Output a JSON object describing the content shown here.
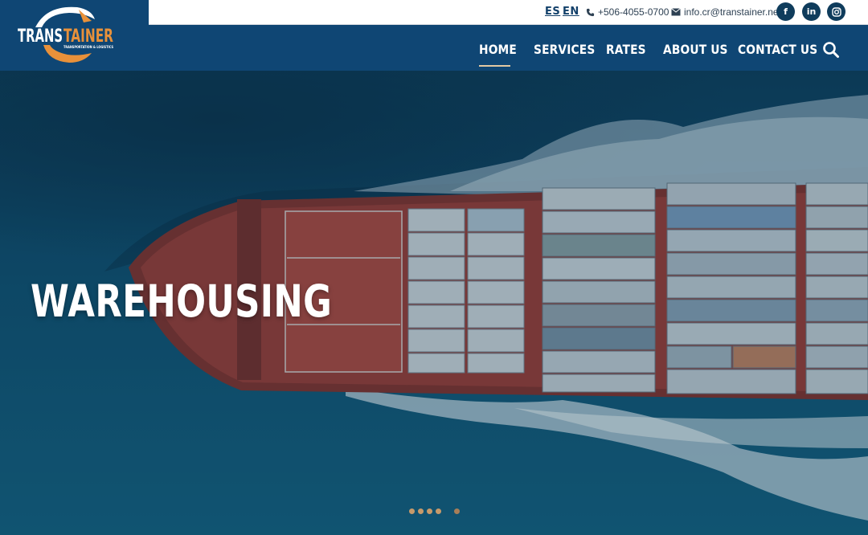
{
  "brand": {
    "name_part1": "TRANS",
    "name_part2": "TAINER",
    "tagline": "TRANSPORTATION & LOGISTICS",
    "colors": {
      "primary": "#0f4674",
      "accent": "#e8913a",
      "dark": "#0f3c5c"
    }
  },
  "topbar": {
    "languages": [
      {
        "code": "ES"
      },
      {
        "code": "EN"
      }
    ],
    "phone": {
      "icon": "phone-icon",
      "text": "+506-4055-0700"
    },
    "email": {
      "icon": "envelope-icon",
      "text": "info.cr@transtainer.net"
    },
    "social": [
      {
        "name": "facebook",
        "icon": "facebook-icon",
        "glyph": "f"
      },
      {
        "name": "linkedin",
        "icon": "linkedin-icon",
        "glyph": "in"
      },
      {
        "name": "instagram",
        "icon": "instagram-icon"
      }
    ]
  },
  "nav": {
    "items": [
      {
        "label": "HOME",
        "active": true
      },
      {
        "label": "SERVICES"
      },
      {
        "label": "RATES"
      },
      {
        "label": "ABOUT US"
      },
      {
        "label": "CONTACT US"
      }
    ],
    "search_icon": "search-icon"
  },
  "hero": {
    "title": "WAREHOUSING",
    "slides_count": 5,
    "active_slide": 5
  }
}
